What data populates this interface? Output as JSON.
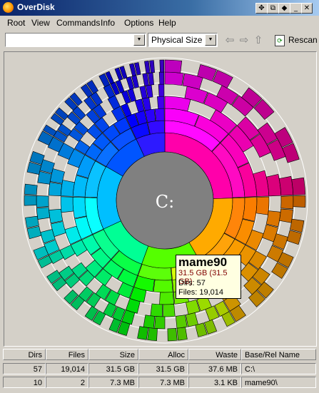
{
  "window": {
    "title": "OverDisk"
  },
  "menu": [
    "Root",
    "View",
    "Commands",
    "Info",
    "Options",
    "Help"
  ],
  "toolbar": {
    "path_value": "",
    "size_mode": "Physical Size",
    "rescan_label": "Rescan"
  },
  "chart": {
    "center_label": "C:"
  },
  "tooltip": {
    "name": "mame90",
    "size": "31.5 GB (31.5 GB)",
    "dirs": "Dirs: 57",
    "files": "Files: 19,014"
  },
  "table": {
    "headers": [
      "Dirs",
      "Files",
      "Size",
      "Alloc",
      "Waste",
      "Base/Rel Name"
    ],
    "rows": [
      [
        "57",
        "19,014",
        "31.5 GB",
        "31.5 GB",
        "37.6 MB",
        "C:\\"
      ],
      [
        "10",
        "2",
        "7.3 MB",
        "7.3 MB",
        "3.1 KB",
        "mame90\\"
      ]
    ]
  },
  "colors": {
    "center": "#808080",
    "window_bg": "#d4d0c8",
    "title_start": "#0a246a",
    "tooltip_bg": "#ffffe1"
  }
}
